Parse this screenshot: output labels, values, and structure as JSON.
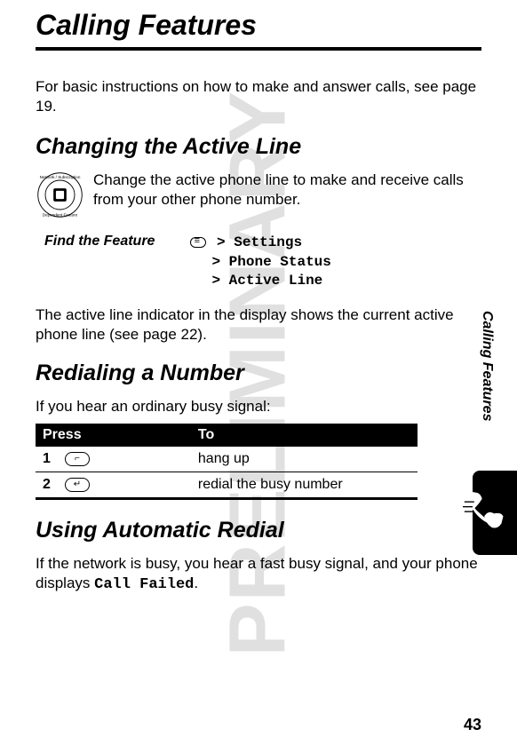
{
  "watermark": "PRELIMINARY",
  "chapter_title": "Calling Features",
  "intro": "For basic instructions on how to make and answer calls, see page 19.",
  "section1": {
    "title": "Changing the Active Line",
    "description": "Change the active phone line to make and receive calls from your other phone number.",
    "find_label": "Find the Feature",
    "menu_path": {
      "line1": "Settings",
      "line2": "Phone Status",
      "line3": "Active Line"
    },
    "footer": "The active line indicator in the display shows the current active phone line (see page 22)."
  },
  "section2": {
    "title": "Redialing a Number",
    "intro": "If you hear an ordinary busy signal:",
    "table": {
      "headers": {
        "press": "Press",
        "to": "To"
      },
      "rows": [
        {
          "num": "1",
          "key": "end-key",
          "action": "hang up"
        },
        {
          "num": "2",
          "key": "send-key",
          "action": "redial the busy number"
        }
      ]
    }
  },
  "section3": {
    "title": "Using Automatic Redial",
    "text_prefix": "If the network is busy, you hear a fast busy signal, and your phone displays ",
    "text_mono": "Call Failed",
    "text_suffix": "."
  },
  "side_label": "Calling Features",
  "page_number": "43"
}
